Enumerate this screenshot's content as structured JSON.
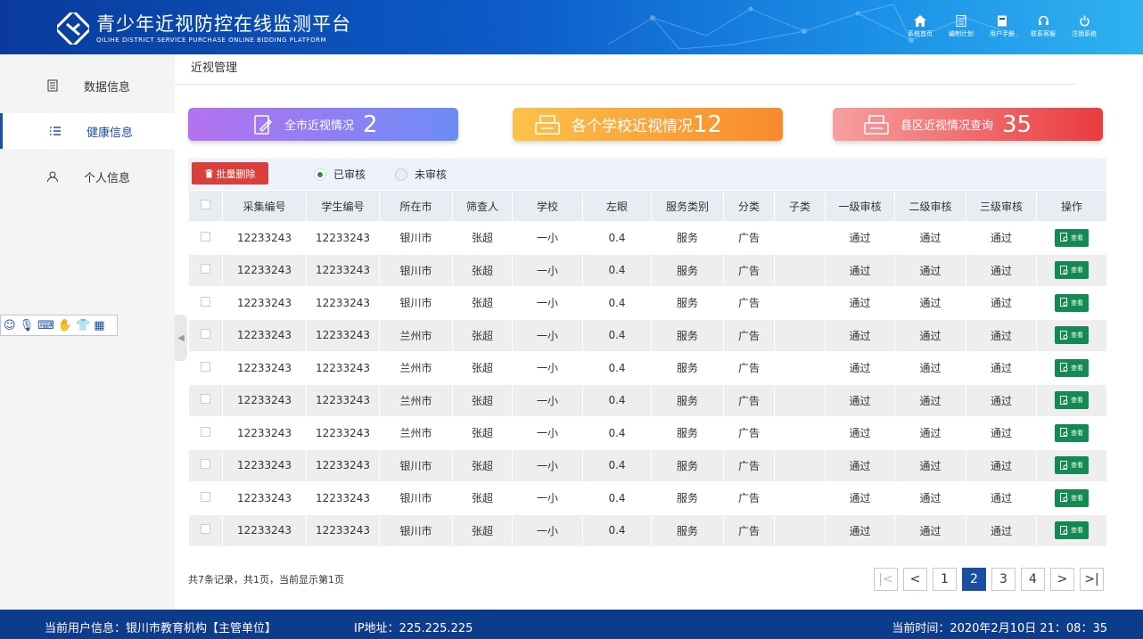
{
  "header": {
    "title": "青少年近视防控在线监测平台",
    "subtitle": "QILIHE DISTRICT SERVICE PURCHASE ONLINE BIDDING PLATFORM",
    "nav": [
      {
        "label": "系统首页",
        "icon": "home-icon"
      },
      {
        "label": "编制计划",
        "icon": "document-icon"
      },
      {
        "label": "用户手册",
        "icon": "book-icon"
      },
      {
        "label": "联系客服",
        "icon": "headset-icon"
      },
      {
        "label": "注销系统",
        "icon": "power-icon"
      }
    ]
  },
  "sidebar": {
    "items": [
      {
        "label": "数据信息",
        "icon": "document-icon",
        "active": false
      },
      {
        "label": "健康信息",
        "icon": "list-icon",
        "active": true
      },
      {
        "label": "个人信息",
        "icon": "user-icon",
        "active": false
      }
    ]
  },
  "breadcrumb": "近视管理",
  "cards": [
    {
      "label": "全市近视情况",
      "count": "2"
    },
    {
      "label": "各个学校近视情况",
      "count": "12"
    },
    {
      "label": "县区近视情况查询",
      "count": "35"
    }
  ],
  "toolbar": {
    "batch_delete": "批量删除",
    "radio_approved": "已审核",
    "radio_pending": "未审核",
    "selected": "已审核"
  },
  "table": {
    "headers": [
      "采集编号",
      "学生编号",
      "所在市",
      "筛查人",
      "学校",
      "左眼",
      "服务类别",
      "分类",
      "子类",
      "一级审核",
      "二级审核",
      "三级审核",
      "操作"
    ],
    "action_label": "查看",
    "rows": [
      [
        "12233243",
        "12233243",
        "银川市",
        "张超",
        "一小",
        "0.4",
        "服务",
        "广告",
        "",
        "通过",
        "通过",
        "通过"
      ],
      [
        "12233243",
        "12233243",
        "银川市",
        "张超",
        "一小",
        "0.4",
        "服务",
        "广告",
        "",
        "通过",
        "通过",
        "通过"
      ],
      [
        "12233243",
        "12233243",
        "银川市",
        "张超",
        "一小",
        "0.4",
        "服务",
        "广告",
        "",
        "通过",
        "通过",
        "通过"
      ],
      [
        "12233243",
        "12233243",
        "兰州市",
        "张超",
        "一小",
        "0.4",
        "服务",
        "广告",
        "",
        "通过",
        "通过",
        "通过"
      ],
      [
        "12233243",
        "12233243",
        "兰州市",
        "张超",
        "一小",
        "0.4",
        "服务",
        "广告",
        "",
        "通过",
        "通过",
        "通过"
      ],
      [
        "12233243",
        "12233243",
        "兰州市",
        "张超",
        "一小",
        "0.4",
        "服务",
        "广告",
        "",
        "通过",
        "通过",
        "通过"
      ],
      [
        "12233243",
        "12233243",
        "兰州市",
        "张超",
        "一小",
        "0.4",
        "服务",
        "广告",
        "",
        "通过",
        "通过",
        "通过"
      ],
      [
        "12233243",
        "12233243",
        "银川市",
        "张超",
        "一小",
        "0.4",
        "服务",
        "广告",
        "",
        "通过",
        "通过",
        "通过"
      ],
      [
        "12233243",
        "12233243",
        "银川市",
        "张超",
        "一小",
        "0.4",
        "服务",
        "广告",
        "",
        "通过",
        "通过",
        "通过"
      ],
      [
        "12233243",
        "12233243",
        "银川市",
        "张超",
        "一小",
        "0.4",
        "服务",
        "广告",
        "",
        "通过",
        "通过",
        "通过"
      ]
    ]
  },
  "pagination": {
    "info": "共7条记录，共1页，当前显示第1页",
    "pages": [
      "1",
      "2",
      "3",
      "4"
    ],
    "current": "2"
  },
  "footer": {
    "user": "当前用户信息：银川市教育机构【主管单位】",
    "ip": "IP地址：225.225.225",
    "time": "当前时间：2020年2月10日 21：08：35"
  }
}
